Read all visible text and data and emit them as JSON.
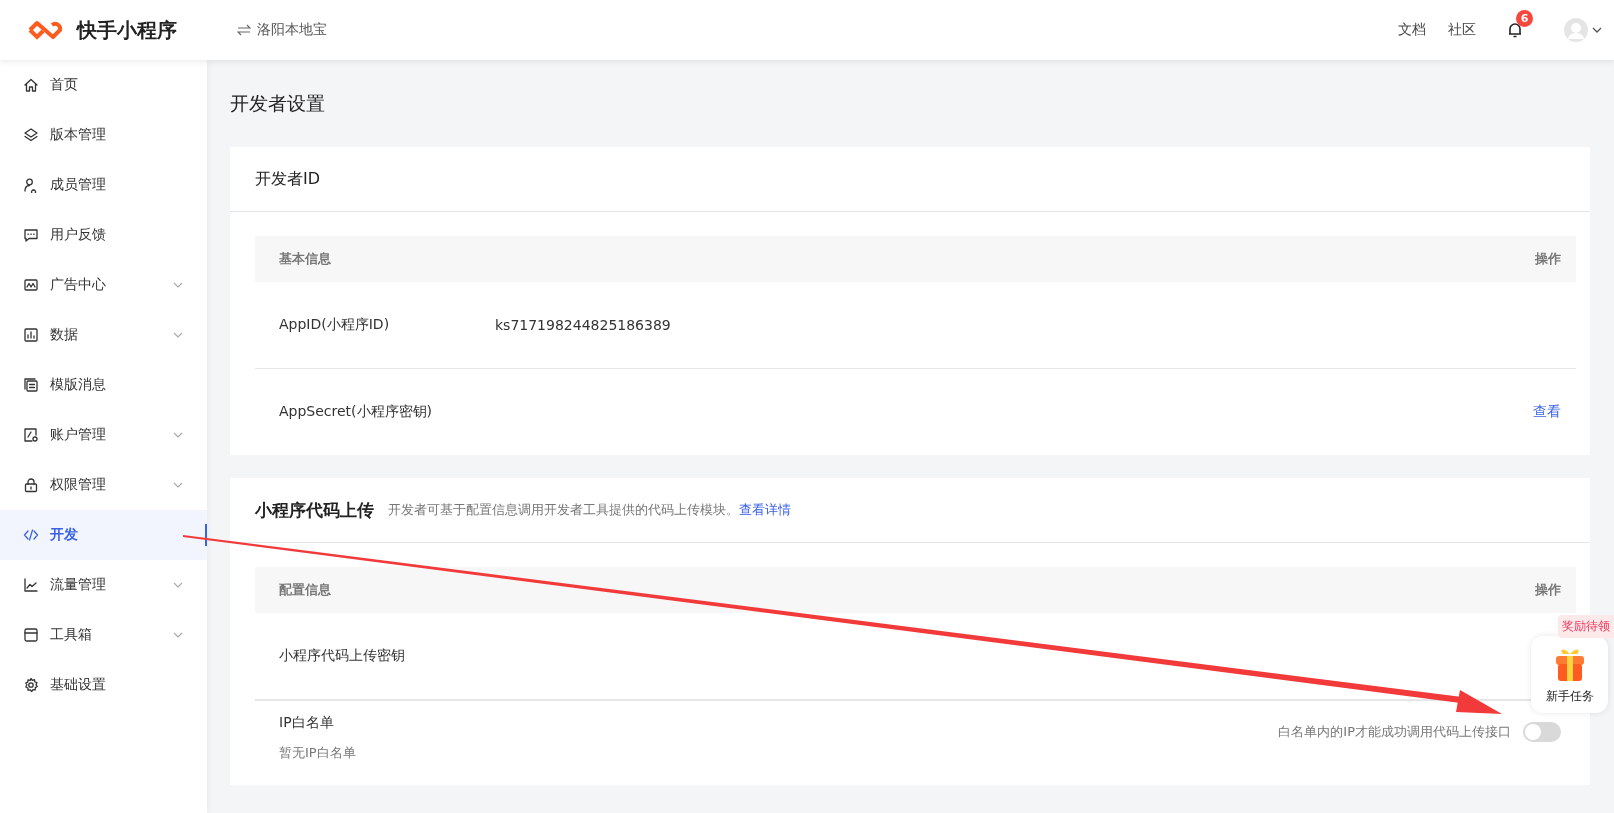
{
  "header": {
    "brand": "快手小程序",
    "app_name": "洛阳本地宝",
    "links": [
      "文档",
      "社区"
    ],
    "notification_count": "6"
  },
  "sidebar": {
    "items": [
      {
        "label": "首页",
        "expandable": false,
        "selected": false
      },
      {
        "label": "版本管理",
        "expandable": false,
        "selected": false
      },
      {
        "label": "成员管理",
        "expandable": false,
        "selected": false
      },
      {
        "label": "用户反馈",
        "expandable": false,
        "selected": false
      },
      {
        "label": "广告中心",
        "expandable": true,
        "selected": false
      },
      {
        "label": "数据",
        "expandable": true,
        "selected": false
      },
      {
        "label": "模版消息",
        "expandable": false,
        "selected": false
      },
      {
        "label": "账户管理",
        "expandable": true,
        "selected": false
      },
      {
        "label": "权限管理",
        "expandable": true,
        "selected": false
      },
      {
        "label": "开发",
        "expandable": false,
        "selected": true
      },
      {
        "label": "流量管理",
        "expandable": true,
        "selected": false
      },
      {
        "label": "工具箱",
        "expandable": true,
        "selected": false
      },
      {
        "label": "基础设置",
        "expandable": false,
        "selected": false
      }
    ]
  },
  "page_title": "开发者设置",
  "developer_id": {
    "title": "开发者ID",
    "table": {
      "header": "基本信息",
      "action_header": "操作",
      "rows": [
        {
          "label": "AppID(小程序ID)",
          "value": "ks717198244825186389"
        },
        {
          "label": "AppSecret(小程序密钥)",
          "action": "查看"
        }
      ]
    }
  },
  "code_upload": {
    "title": "小程序代码上传",
    "description": "开发者可基于配置信息调用开发者工具提供的代码上传模块。",
    "link": "查看详情",
    "table": {
      "header": "配置信息",
      "action_header": "操作",
      "rows": [
        {
          "label": "小程序代码上传密钥"
        }
      ]
    },
    "whitelist": {
      "label": "IP白名单",
      "empty_text": "暂无IP白名单",
      "hint": "白名单内的IP才能成功调用代码上传接口",
      "on": false
    }
  },
  "floating_widget": {
    "tag": "奖励待领",
    "label": "新手任务"
  }
}
